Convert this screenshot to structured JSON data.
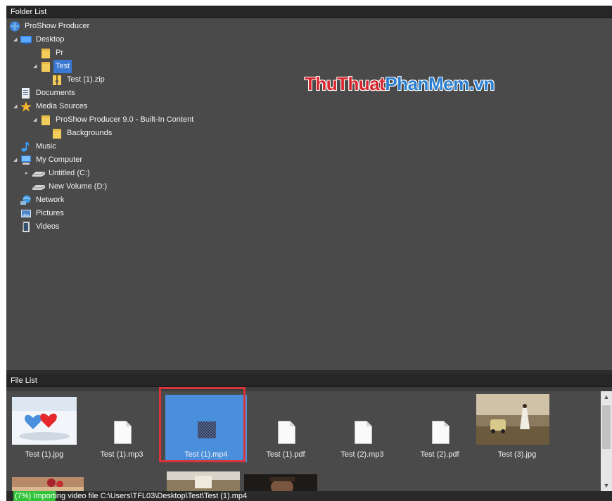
{
  "folder_panel": {
    "title": "Folder List",
    "items": [
      {
        "label": "ProShow Producer",
        "icon": "proshow-app-icon"
      },
      {
        "label": "Desktop",
        "icon": "desktop-icon",
        "expanded": true
      },
      {
        "label": "Pr",
        "icon": "folder-icon"
      },
      {
        "label": "Test",
        "icon": "folder-icon",
        "selected": true,
        "expanded": true
      },
      {
        "label": "Test (1).zip",
        "icon": "zip-folder-icon"
      },
      {
        "label": "Documents",
        "icon": "documents-icon"
      },
      {
        "label": "Media Sources",
        "icon": "star-icon",
        "expanded": true
      },
      {
        "label": "ProShow Producer 9.0 - Built-In Content",
        "icon": "folder-icon",
        "expanded": true
      },
      {
        "label": "Backgrounds",
        "icon": "folder-icon"
      },
      {
        "label": "Music",
        "icon": "music-note-icon"
      },
      {
        "label": "My Computer",
        "icon": "computer-icon",
        "expanded": true
      },
      {
        "label": "Untitled (C:)",
        "icon": "drive-icon",
        "collapsed": true
      },
      {
        "label": "New Volume (D:)",
        "icon": "drive-icon"
      },
      {
        "label": "Network",
        "icon": "network-icon"
      },
      {
        "label": "Pictures",
        "icon": "pictures-icon"
      },
      {
        "label": "Videos",
        "icon": "videos-icon"
      }
    ]
  },
  "watermark": {
    "part1": "ThuThuat",
    "part2": "PhanMem.vn"
  },
  "file_panel": {
    "title": "File List",
    "files": [
      {
        "name": "Test (1).jpg",
        "type": "image"
      },
      {
        "name": "Test (1).mp3",
        "type": "document"
      },
      {
        "name": "Test (1).mp4",
        "type": "video",
        "selected": true
      },
      {
        "name": "Test (1).pdf",
        "type": "document"
      },
      {
        "name": "Test (2).mp3",
        "type": "document"
      },
      {
        "name": "Test (2).pdf",
        "type": "document"
      },
      {
        "name": "Test (3).jpg",
        "type": "image"
      }
    ]
  },
  "status": {
    "text": "(7%) Importing video file C:\\Users\\TFL03\\Desktop\\Test\\Test (1).mp4",
    "progress_percent": 7
  },
  "colors": {
    "panel_bg": "#4a4a4a",
    "header_bg": "#262626",
    "selection": "#3b78d4",
    "highlight_box": "#d9343a",
    "progress": "#31c43a",
    "folder": "#f3cd5c"
  }
}
